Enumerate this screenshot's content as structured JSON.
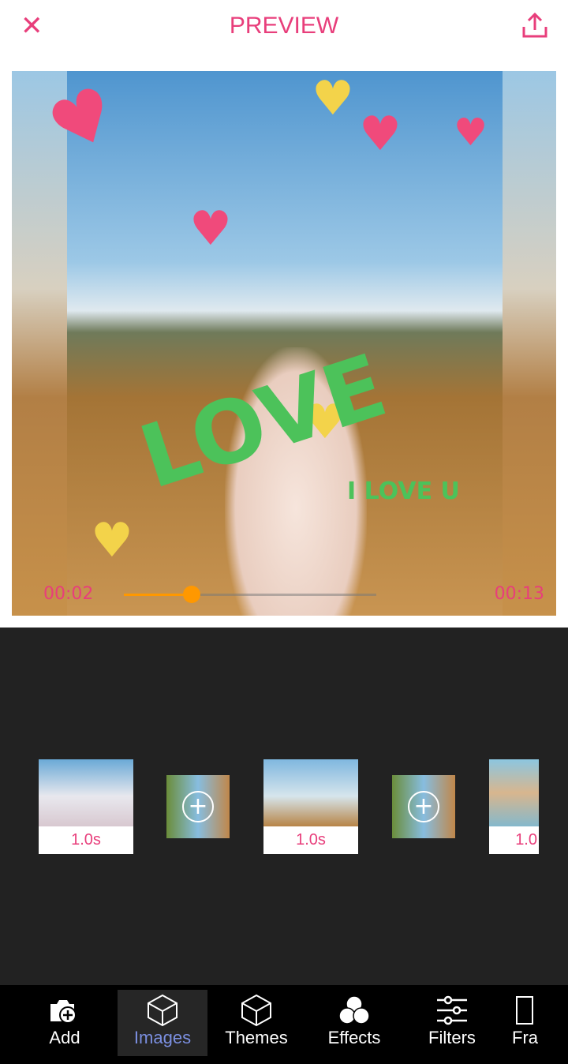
{
  "header": {
    "title": "PREVIEW",
    "close_icon": "close-icon",
    "share_icon": "share-icon"
  },
  "preview": {
    "overlay_text": "LOVE",
    "overlay_subtext": "I LOVE U",
    "current_time": "00:02",
    "total_time": "00:13",
    "progress": 0.27,
    "accent": "#ff9800"
  },
  "timeline": {
    "clips": [
      {
        "duration": "1.0s"
      },
      {
        "duration": "1.0s"
      },
      {
        "duration": "1.0"
      }
    ]
  },
  "nav": {
    "items": [
      {
        "label": "Add",
        "icon": "camera-add-icon"
      },
      {
        "label": "Images",
        "icon": "cube-icon",
        "active": true
      },
      {
        "label": "Themes",
        "icon": "cube-icon"
      },
      {
        "label": "Effects",
        "icon": "circles-icon"
      },
      {
        "label": "Filters",
        "icon": "sliders-icon"
      },
      {
        "label": "Fra",
        "icon": "frame-icon"
      }
    ]
  },
  "colors": {
    "brand": "#e83e7b",
    "active_tab": "#7b8fe0"
  }
}
